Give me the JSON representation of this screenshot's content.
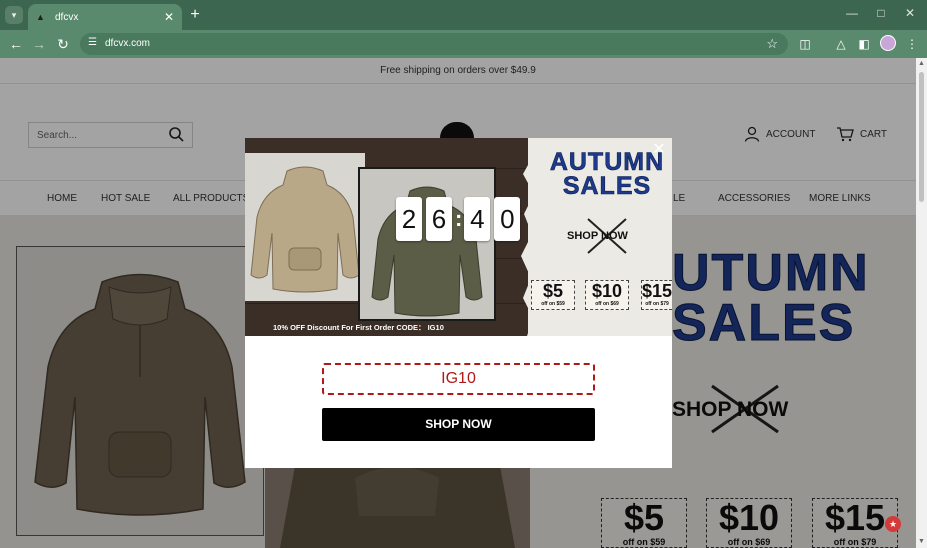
{
  "browser": {
    "tab_title": "dfcvx",
    "url": "dfcvx.com",
    "icons": [
      "tab-search-icon",
      "new-tab-icon",
      "back-icon",
      "forward-icon",
      "reload-icon",
      "site-info-icon",
      "bookmark-star-icon",
      "extensions-icon",
      "labs-icon",
      "side-panel-icon",
      "profile-avatar",
      "menu-kebab-icon",
      "minimize-icon",
      "maximize-icon",
      "window-close-icon"
    ]
  },
  "site": {
    "announcement": "Free shipping on orders over $49.9",
    "search_placeholder": "Search...",
    "account_label": "ACCOUNT",
    "cart_label": "CART",
    "menu": [
      "HOME",
      "HOT SALE",
      "ALL PRODUCTS",
      "LE",
      "ACCESSORIES",
      "MORE LINKS"
    ],
    "hero": {
      "title": "AUTUMN SALES",
      "title_visible": "UTUMN",
      "title_line2": "SALES",
      "shop_now": "SHOP NOW",
      "coupons": [
        {
          "amount": "$5",
          "condition": "off on $59",
          "side": "$5"
        },
        {
          "amount": "$10",
          "condition": "off on $69",
          "side": "$10"
        },
        {
          "amount": "$15",
          "condition": "off on $79",
          "side": "$15"
        }
      ]
    }
  },
  "popup": {
    "banner_title_line1": "AUTUMN",
    "banner_title_line2": "SALES",
    "banner_shop_now": "SHOP NOW",
    "banner_coupons": [
      {
        "amount": "$5",
        "condition": "off on $59"
      },
      {
        "amount": "$10",
        "condition": "off on $69"
      },
      {
        "amount": "$15",
        "condition": "off on $79"
      }
    ],
    "promo_text": "10% OFF Discount For First Order CODE： IG10",
    "timer_digits": [
      "2",
      "6",
      "4",
      "0"
    ],
    "code": "IG10",
    "cta_label": "SHOP NOW"
  },
  "colors": {
    "chrome_dark": "#3d6650",
    "chrome_light": "#5a8a6e",
    "autumn_blue": "#1e3a8c",
    "code_red": "#b01818",
    "cta_black": "#000000"
  }
}
